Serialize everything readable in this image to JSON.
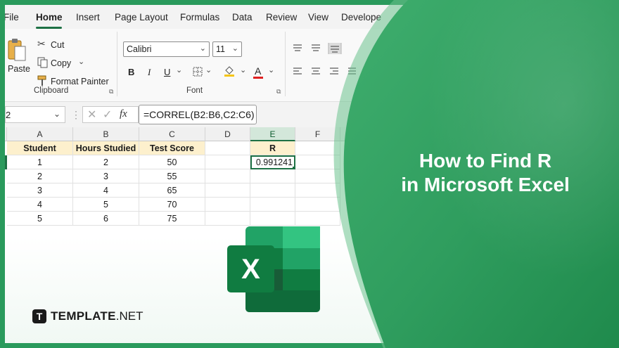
{
  "menu": {
    "items": [
      "File",
      "Home",
      "Insert",
      "Page Layout",
      "Formulas",
      "Data",
      "Review",
      "View",
      "Develope"
    ],
    "active": "Home"
  },
  "ribbon": {
    "clipboard": {
      "paste": "Paste",
      "cut": "Cut",
      "copy": "Copy",
      "format_painter": "Format Painter",
      "label": "Clipboard"
    },
    "font": {
      "name": "Calibri",
      "size": "11",
      "bold": "B",
      "italic": "I",
      "underline": "U",
      "font_color_glyph": "A",
      "label": "Font"
    }
  },
  "formula_bar": {
    "name_box": "2",
    "fx": "fx",
    "formula": "=CORREL(B2:B6,C2:C6)"
  },
  "sheet": {
    "columns": [
      "A",
      "B",
      "C",
      "D",
      "E",
      "F"
    ],
    "selected_column": "E",
    "headers": [
      "Student",
      "Hours Studied",
      "Test Score"
    ],
    "r_header": "R",
    "r_value": "0.991241",
    "rows": [
      [
        "1",
        "2",
        "50"
      ],
      [
        "2",
        "3",
        "55"
      ],
      [
        "3",
        "4",
        "65"
      ],
      [
        "4",
        "5",
        "70"
      ],
      [
        "5",
        "6",
        "75"
      ]
    ]
  },
  "headline": {
    "line1": "How to Find R",
    "line2": "in Microsoft Excel"
  },
  "logo": {
    "letter": "X"
  },
  "brand": {
    "mark": "T",
    "bold": "TEMPLATE",
    "rest": ".NET"
  },
  "colors": {
    "excel_green": "#1e7145",
    "overlay_green": "#2a9a5c",
    "header_fill": "#fdf0cd"
  }
}
